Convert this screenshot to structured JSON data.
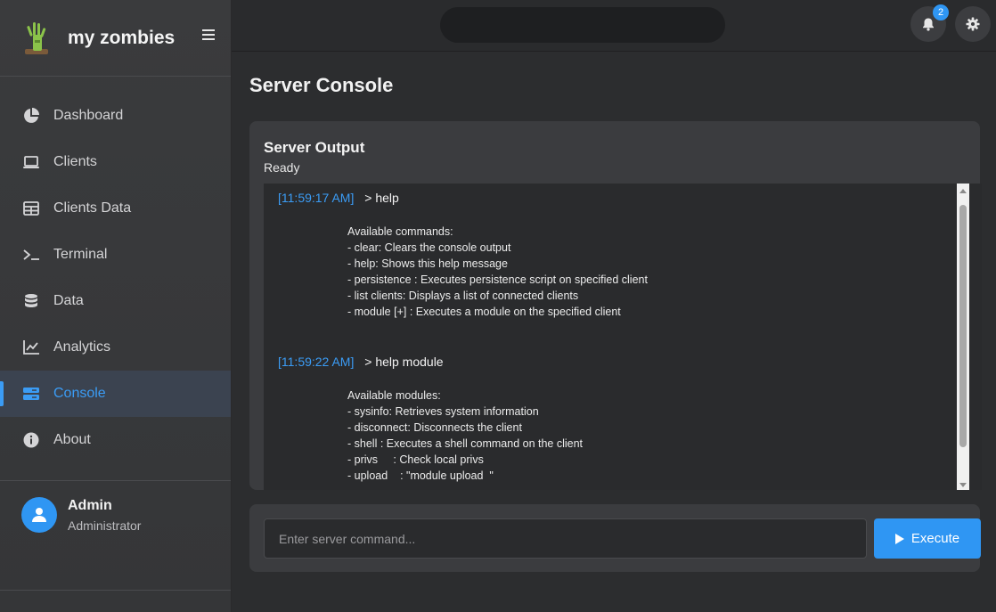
{
  "app": {
    "name": "my zombies",
    "logo_icon": "zombie-hand-icon"
  },
  "sidebar": {
    "items": [
      {
        "label": "Dashboard",
        "icon": "pie-chart-icon",
        "active": false
      },
      {
        "label": "Clients",
        "icon": "laptop-icon",
        "active": false
      },
      {
        "label": "Clients Data",
        "icon": "table-icon",
        "active": false
      },
      {
        "label": "Terminal",
        "icon": "terminal-icon",
        "active": false
      },
      {
        "label": "Data",
        "icon": "database-icon",
        "active": false
      },
      {
        "label": "Analytics",
        "icon": "line-chart-icon",
        "active": false
      },
      {
        "label": "Console",
        "icon": "server-icon",
        "active": true
      },
      {
        "label": "About",
        "icon": "info-icon",
        "active": false
      }
    ],
    "user": {
      "name": "Admin",
      "role": "Administrator"
    }
  },
  "topbar": {
    "search_value": "",
    "notifications_count": "2"
  },
  "main": {
    "title": "Server Console",
    "output": {
      "title": "Server Output",
      "status": "Ready",
      "entries": [
        {
          "time": "[11:59:17 AM]",
          "command": "> help",
          "body": "Available commands:\n- clear: Clears the console output\n- help: Shows this help message\n- persistence : Executes persistence script on specified client\n- list clients: Displays a list of connected clients\n- module [+] : Executes a module on the specified client"
        },
        {
          "time": "[11:59:22 AM]",
          "command": "> help module",
          "body": "Available modules:\n- sysinfo: Retrieves system information\n- disconnect: Disconnects the client\n- shell : Executes a shell command on the client\n- privs     : Check local privs\n- upload    : \"module upload  \""
        }
      ]
    },
    "command": {
      "placeholder": "Enter server command...",
      "value": "",
      "execute_label": "Execute"
    }
  },
  "colors": {
    "accent": "#2f96f3",
    "timestamp": "#3b9cf5"
  }
}
